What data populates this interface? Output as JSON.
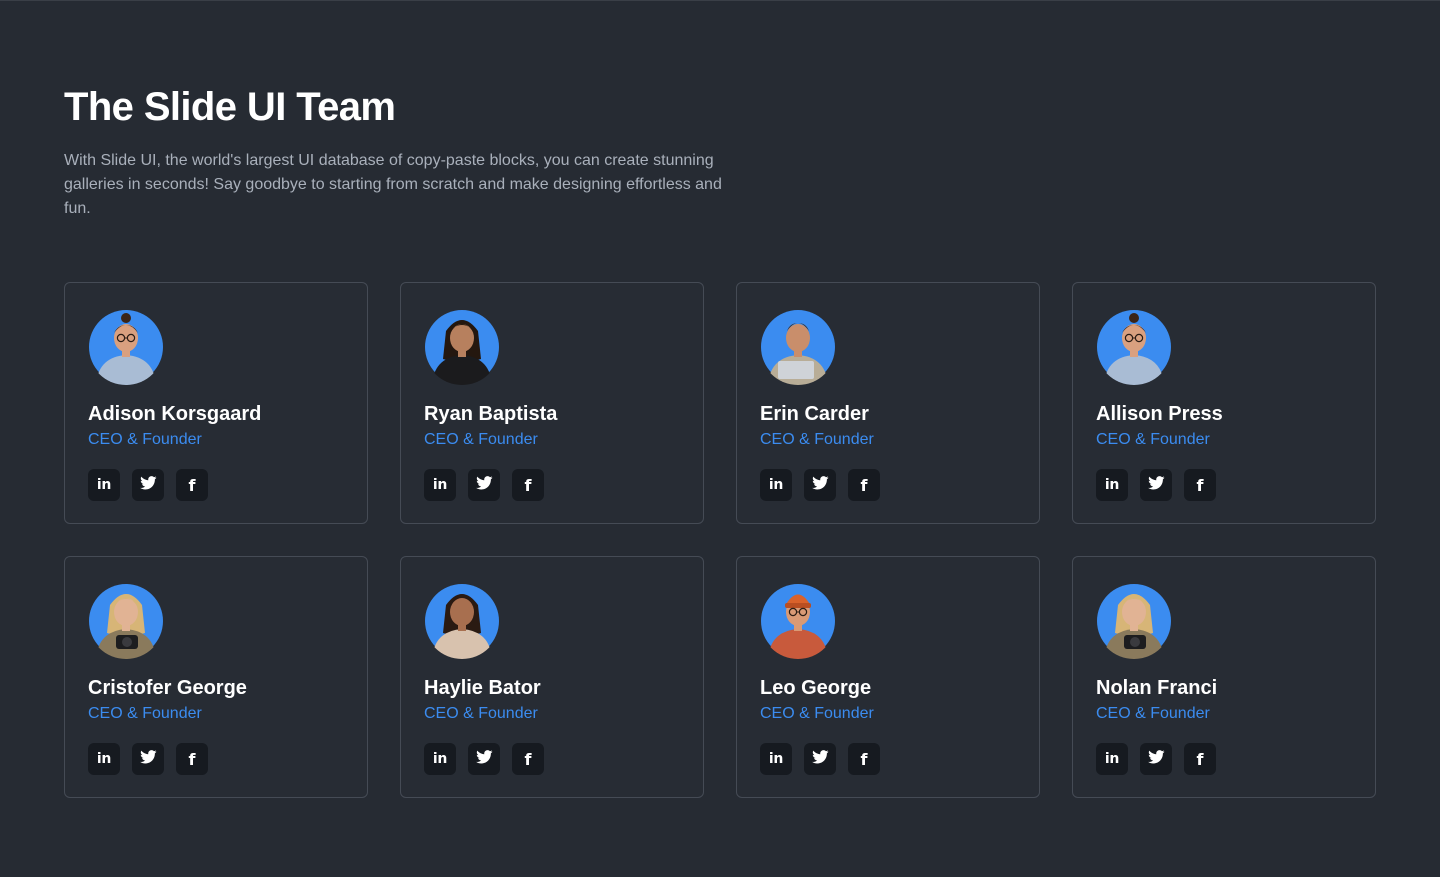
{
  "header": {
    "title": "The Slide UI Team",
    "description": "With Slide UI, the world's largest UI database of copy-paste blocks, you can create stunning galleries in seconds! Say goodbye to starting from scratch and make designing effortless and fun."
  },
  "colors": {
    "background": "#262b33",
    "card_border": "#454b55",
    "accent": "#3b8cf0",
    "avatar_bg": "#3b8cf0",
    "icon_bg": "#161a20"
  },
  "socials": {
    "linkedin_icon": "in",
    "twitter_icon": "twitter-bird",
    "facebook_icon": "f"
  },
  "members": [
    {
      "name": "Adison Korsgaard",
      "role": "CEO & Founder",
      "portrait": "woman-glasses-denim-shirt"
    },
    {
      "name": "Ryan Baptista",
      "role": "CEO & Founder",
      "portrait": "woman-dark-hair-black-shirt"
    },
    {
      "name": "Erin Carder",
      "role": "CEO & Founder",
      "portrait": "man-holding-laptop"
    },
    {
      "name": "Allison Press",
      "role": "CEO & Founder",
      "portrait": "woman-glasses-denim-shirt"
    },
    {
      "name": "Cristofer George",
      "role": "CEO & Founder",
      "portrait": "woman-blonde-camera"
    },
    {
      "name": "Haylie Bator",
      "role": "CEO & Founder",
      "portrait": "woman-curly-floral-shirt"
    },
    {
      "name": "Leo George",
      "role": "CEO & Founder",
      "portrait": "man-beanie-glasses"
    },
    {
      "name": "Nolan Franci",
      "role": "CEO & Founder",
      "portrait": "woman-blonde-camera"
    }
  ]
}
